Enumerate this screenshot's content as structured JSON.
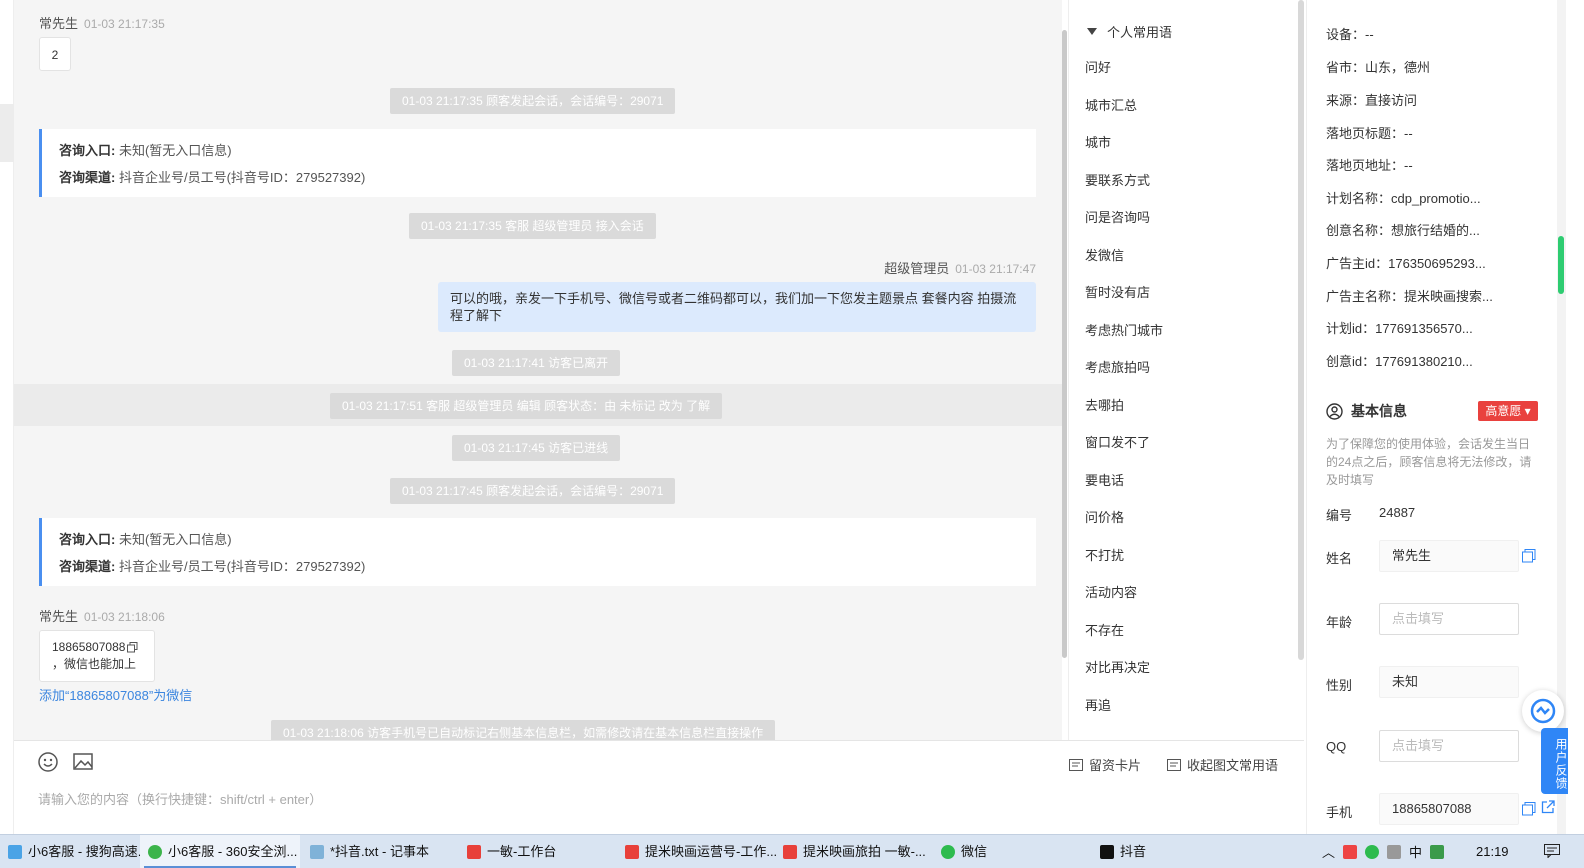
{
  "chat": {
    "msg1": {
      "sender": "常先生",
      "time": "01-03 21:17:35",
      "text": "2"
    },
    "sys1": "01-03 21:17:35 顾客发起会话，会话编号：29071",
    "info1": {
      "entry_label": "咨询入口:",
      "entry_value": "未知(暂无入口信息)",
      "channel_label": "咨询渠道:",
      "channel_value": "抖音企业号/员工号(抖音号ID：279527392)"
    },
    "sys2": "01-03 21:17:35 客服 超级管理员 接入会话",
    "msg2": {
      "sender": "超级管理员",
      "time": "01-03 21:17:47",
      "text": "可以的哦，亲发一下手机号、微信号或者二维码都可以，我们加一下您发主题景点 套餐内容 拍摄流程了解下"
    },
    "sys3": "01-03 21:17:41 访客已离开",
    "sys4": "01-03 21:17:51 客服 超级管理员 编辑 顾客状态：由 未标记 改为 了解",
    "sys5": "01-03 21:17:45 访客已进线",
    "sys6": "01-03 21:17:45 顾客发起会话，会话编号：29071",
    "info2": {
      "entry_label": "咨询入口:",
      "entry_value": "未知(暂无入口信息)",
      "channel_label": "咨询渠道:",
      "channel_value": "抖音企业号/员工号(抖音号ID：279527392)"
    },
    "msg3": {
      "sender": "常先生",
      "time": "01-03 21:18:06",
      "phone": "18865807088",
      "text": "，微信也能加上"
    },
    "add_wechat_link": "添加“18865807088”为微信",
    "sys7": "01-03 21:18:06 访客手机号已自动标记右侧基本信息栏，如需修改请在基本信息栏直接操作"
  },
  "input": {
    "placeholder": "请输入您的内容（换行快捷键：shift/ctrl + enter）",
    "leave_card": "留资卡片",
    "collapse_phrases": "收起图文常用语"
  },
  "phrases": {
    "title": "个人常用语",
    "items": [
      "问好",
      "城市汇总",
      "城市",
      "要联系方式",
      "问是咨询吗",
      "发微信",
      "暂时没有店",
      "考虑热门城市",
      "考虑旅拍吗",
      "去哪拍",
      "窗口发不了",
      "要电话",
      "问价格",
      "不打扰",
      "活动内容",
      "不存在",
      "对比再决定",
      "再追"
    ]
  },
  "info": {
    "device": "设备：--",
    "region": "省市：山东，德州",
    "source": "来源：直接访问",
    "landing_title": "落地页标题：--",
    "landing_url": "落地页地址：--",
    "plan_name": "计划名称：cdp_promotio...",
    "creative_name": "创意名称：想旅行结婚的...",
    "advertiser_id": "广告主id：176350695293...",
    "advertiser_name": "广告主名称：提米映画搜索...",
    "plan_id": "计划id：177691356570...",
    "creative_id": "创意id：177691380210...",
    "basic_title": "基本信息",
    "intent": "高意愿",
    "notice": "为了保障您的使用体验，会话发生当日的24点之后，顾客信息将无法修改，请及时填写",
    "id_label": "编号",
    "id_value": "24887",
    "name_label": "姓名",
    "name_value": "常先生",
    "age_label": "年龄",
    "age_placeholder": "点击填写",
    "gender_label": "性别",
    "gender_value": "未知",
    "qq_label": "QQ",
    "qq_placeholder": "点击填写",
    "phone_label": "手机",
    "phone_value": "18865807088"
  },
  "feedback": {
    "label": "用户反馈"
  },
  "taskbar": {
    "tasks": [
      "小6客服 - 搜狗高速...",
      "小6客服 - 360安全浏...",
      "*抖音.txt - 记事本",
      "一敏-工作台",
      "提米映画运营号-工作...",
      "提米映画旅拍 一敏-...",
      "微信",
      "抖音"
    ],
    "ime": "中",
    "clock": "21:19"
  },
  "colors": {
    "accent": "#2f86f6",
    "badge": "#e9413e",
    "agent_bubble": "#dceafd",
    "sys_pill": "#dadada"
  }
}
